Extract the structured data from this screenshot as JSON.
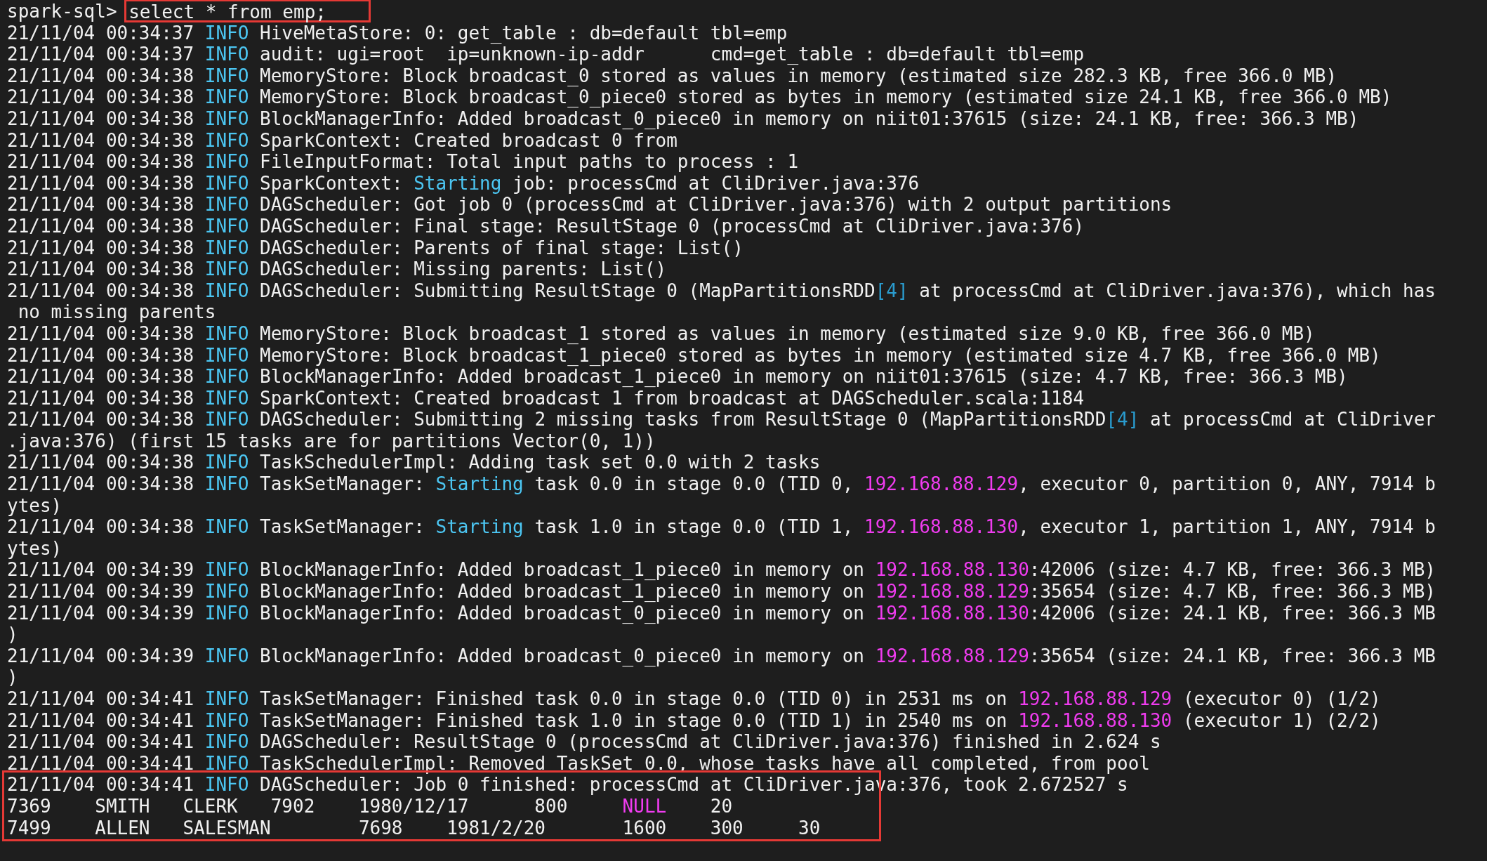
{
  "terminal": {
    "prompt_line": {
      "prompt": "spark-sql> ",
      "command": "select * from emp;",
      "command_boxed": true
    },
    "log_lines": [
      [
        {
          "kind": "plain",
          "text": "21/11/04 00:34:37 "
        },
        {
          "kind": "level",
          "text": "INFO"
        },
        {
          "kind": "plain",
          "text": " HiveMetaStore: 0: get_table : db=default tbl=emp"
        }
      ],
      [
        {
          "kind": "plain",
          "text": "21/11/04 00:34:37 "
        },
        {
          "kind": "level",
          "text": "INFO"
        },
        {
          "kind": "plain",
          "text": " audit: ugi=root  ip=unknown-ip-addr      cmd=get_table : db=default tbl=emp"
        }
      ],
      [
        {
          "kind": "plain",
          "text": "21/11/04 00:34:38 "
        },
        {
          "kind": "level",
          "text": "INFO"
        },
        {
          "kind": "plain",
          "text": " MemoryStore: Block broadcast_0 stored as values in memory (estimated size 282.3 KB, free 366.0 MB)"
        }
      ],
      [
        {
          "kind": "plain",
          "text": "21/11/04 00:34:38 "
        },
        {
          "kind": "level",
          "text": "INFO"
        },
        {
          "kind": "plain",
          "text": " MemoryStore: Block broadcast_0_piece0 stored as bytes in memory (estimated size 24.1 KB, free 366.0 MB)"
        }
      ],
      [
        {
          "kind": "plain",
          "text": "21/11/04 00:34:38 "
        },
        {
          "kind": "level",
          "text": "INFO"
        },
        {
          "kind": "plain",
          "text": " BlockManagerInfo: Added broadcast_0_piece0 in memory on niit01:37615 (size: 24.1 KB, free: 366.3 MB)"
        }
      ],
      [
        {
          "kind": "plain",
          "text": "21/11/04 00:34:38 "
        },
        {
          "kind": "level",
          "text": "INFO"
        },
        {
          "kind": "plain",
          "text": " SparkContext: Created broadcast 0 from"
        }
      ],
      [
        {
          "kind": "plain",
          "text": "21/11/04 00:34:38 "
        },
        {
          "kind": "level",
          "text": "INFO"
        },
        {
          "kind": "plain",
          "text": " FileInputFormat: Total input paths to process : 1"
        }
      ],
      [
        {
          "kind": "plain",
          "text": "21/11/04 00:34:38 "
        },
        {
          "kind": "level",
          "text": "INFO"
        },
        {
          "kind": "plain",
          "text": " SparkContext: "
        },
        {
          "kind": "keyword",
          "text": "Starting"
        },
        {
          "kind": "plain",
          "text": " job: processCmd at CliDriver.java:376"
        }
      ],
      [
        {
          "kind": "plain",
          "text": "21/11/04 00:34:38 "
        },
        {
          "kind": "level",
          "text": "INFO"
        },
        {
          "kind": "plain",
          "text": " DAGScheduler: Got job 0 (processCmd at CliDriver.java:376) with 2 output partitions"
        }
      ],
      [
        {
          "kind": "plain",
          "text": "21/11/04 00:34:38 "
        },
        {
          "kind": "level",
          "text": "INFO"
        },
        {
          "kind": "plain",
          "text": " DAGScheduler: Final stage: ResultStage 0 (processCmd at CliDriver.java:376)"
        }
      ],
      [
        {
          "kind": "plain",
          "text": "21/11/04 00:34:38 "
        },
        {
          "kind": "level",
          "text": "INFO"
        },
        {
          "kind": "plain",
          "text": " DAGScheduler: Parents of final stage: List()"
        }
      ],
      [
        {
          "kind": "plain",
          "text": "21/11/04 00:34:38 "
        },
        {
          "kind": "level",
          "text": "INFO"
        },
        {
          "kind": "plain",
          "text": " DAGScheduler: Missing parents: List()"
        }
      ],
      [
        {
          "kind": "plain",
          "text": "21/11/04 00:34:38 "
        },
        {
          "kind": "level",
          "text": "INFO"
        },
        {
          "kind": "plain",
          "text": " DAGScheduler: Submitting ResultStage 0 (MapPartitionsRDD"
        },
        {
          "kind": "index",
          "text": "[4]"
        },
        {
          "kind": "plain",
          "text": " at processCmd at CliDriver.java:376), which has"
        }
      ],
      [
        {
          "kind": "plain",
          "text": " no missing parents"
        }
      ],
      [
        {
          "kind": "plain",
          "text": "21/11/04 00:34:38 "
        },
        {
          "kind": "level",
          "text": "INFO"
        },
        {
          "kind": "plain",
          "text": " MemoryStore: Block broadcast_1 stored as values in memory (estimated size 9.0 KB, free 366.0 MB)"
        }
      ],
      [
        {
          "kind": "plain",
          "text": "21/11/04 00:34:38 "
        },
        {
          "kind": "level",
          "text": "INFO"
        },
        {
          "kind": "plain",
          "text": " MemoryStore: Block broadcast_1_piece0 stored as bytes in memory (estimated size 4.7 KB, free 366.0 MB)"
        }
      ],
      [
        {
          "kind": "plain",
          "text": "21/11/04 00:34:38 "
        },
        {
          "kind": "level",
          "text": "INFO"
        },
        {
          "kind": "plain",
          "text": " BlockManagerInfo: Added broadcast_1_piece0 in memory on niit01:37615 (size: 4.7 KB, free: 366.3 MB)"
        }
      ],
      [
        {
          "kind": "plain",
          "text": "21/11/04 00:34:38 "
        },
        {
          "kind": "level",
          "text": "INFO"
        },
        {
          "kind": "plain",
          "text": " SparkContext: Created broadcast 1 from broadcast at DAGScheduler.scala:1184"
        }
      ],
      [
        {
          "kind": "plain",
          "text": "21/11/04 00:34:38 "
        },
        {
          "kind": "level",
          "text": "INFO"
        },
        {
          "kind": "plain",
          "text": " DAGScheduler: Submitting 2 missing tasks from ResultStage 0 (MapPartitionsRDD"
        },
        {
          "kind": "index",
          "text": "[4]"
        },
        {
          "kind": "plain",
          "text": " at processCmd at CliDriver"
        }
      ],
      [
        {
          "kind": "plain",
          "text": ".java:376) (first 15 tasks are for partitions Vector(0, 1))"
        }
      ],
      [
        {
          "kind": "plain",
          "text": "21/11/04 00:34:38 "
        },
        {
          "kind": "level",
          "text": "INFO"
        },
        {
          "kind": "plain",
          "text": " TaskSchedulerImpl: Adding task set 0.0 with 2 tasks"
        }
      ],
      [
        {
          "kind": "plain",
          "text": "21/11/04 00:34:38 "
        },
        {
          "kind": "level",
          "text": "INFO"
        },
        {
          "kind": "plain",
          "text": " TaskSetManager: "
        },
        {
          "kind": "keyword",
          "text": "Starting"
        },
        {
          "kind": "plain",
          "text": " task 0.0 in stage 0.0 (TID 0, "
        },
        {
          "kind": "ip",
          "text": "192.168.88.129"
        },
        {
          "kind": "plain",
          "text": ", executor 0, partition 0, ANY, 7914 b"
        }
      ],
      [
        {
          "kind": "plain",
          "text": "ytes)"
        }
      ],
      [
        {
          "kind": "plain",
          "text": "21/11/04 00:34:38 "
        },
        {
          "kind": "level",
          "text": "INFO"
        },
        {
          "kind": "plain",
          "text": " TaskSetManager: "
        },
        {
          "kind": "keyword",
          "text": "Starting"
        },
        {
          "kind": "plain",
          "text": " task 1.0 in stage 0.0 (TID 1, "
        },
        {
          "kind": "ip",
          "text": "192.168.88.130"
        },
        {
          "kind": "plain",
          "text": ", executor 1, partition 1, ANY, 7914 b"
        }
      ],
      [
        {
          "kind": "plain",
          "text": "ytes)"
        }
      ],
      [
        {
          "kind": "plain",
          "text": "21/11/04 00:34:39 "
        },
        {
          "kind": "level",
          "text": "INFO"
        },
        {
          "kind": "plain",
          "text": " BlockManagerInfo: Added broadcast_1_piece0 in memory on "
        },
        {
          "kind": "ip",
          "text": "192.168.88.130"
        },
        {
          "kind": "plain",
          "text": ":42006 (size: 4.7 KB, free: 366.3 MB)"
        }
      ],
      [
        {
          "kind": "plain",
          "text": "21/11/04 00:34:39 "
        },
        {
          "kind": "level",
          "text": "INFO"
        },
        {
          "kind": "plain",
          "text": " BlockManagerInfo: Added broadcast_1_piece0 in memory on "
        },
        {
          "kind": "ip",
          "text": "192.168.88.129"
        },
        {
          "kind": "plain",
          "text": ":35654 (size: 4.7 KB, free: 366.3 MB)"
        }
      ],
      [
        {
          "kind": "plain",
          "text": "21/11/04 00:34:39 "
        },
        {
          "kind": "level",
          "text": "INFO"
        },
        {
          "kind": "plain",
          "text": " BlockManagerInfo: Added broadcast_0_piece0 in memory on "
        },
        {
          "kind": "ip",
          "text": "192.168.88.130"
        },
        {
          "kind": "plain",
          "text": ":42006 (size: 24.1 KB, free: 366.3 MB"
        }
      ],
      [
        {
          "kind": "plain",
          "text": ")"
        }
      ],
      [
        {
          "kind": "plain",
          "text": "21/11/04 00:34:39 "
        },
        {
          "kind": "level",
          "text": "INFO"
        },
        {
          "kind": "plain",
          "text": " BlockManagerInfo: Added broadcast_0_piece0 in memory on "
        },
        {
          "kind": "ip",
          "text": "192.168.88.129"
        },
        {
          "kind": "plain",
          "text": ":35654 (size: 24.1 KB, free: 366.3 MB"
        }
      ],
      [
        {
          "kind": "plain",
          "text": ")"
        }
      ],
      [
        {
          "kind": "plain",
          "text": "21/11/04 00:34:41 "
        },
        {
          "kind": "level",
          "text": "INFO"
        },
        {
          "kind": "plain",
          "text": " TaskSetManager: Finished task 0.0 in stage 0.0 (TID 0) in 2531 ms on "
        },
        {
          "kind": "ip",
          "text": "192.168.88.129"
        },
        {
          "kind": "plain",
          "text": " (executor 0) (1/2)"
        }
      ],
      [
        {
          "kind": "plain",
          "text": "21/11/04 00:34:41 "
        },
        {
          "kind": "level",
          "text": "INFO"
        },
        {
          "kind": "plain",
          "text": " TaskSetManager: Finished task 1.0 in stage 0.0 (TID 1) in 2540 ms on "
        },
        {
          "kind": "ip",
          "text": "192.168.88.130"
        },
        {
          "kind": "plain",
          "text": " (executor 1) (2/2)"
        }
      ],
      [
        {
          "kind": "plain",
          "text": "21/11/04 00:34:41 "
        },
        {
          "kind": "level",
          "text": "INFO"
        },
        {
          "kind": "plain",
          "text": " DAGScheduler: ResultStage 0 (processCmd at CliDriver.java:376) finished in 2.624 s"
        }
      ],
      [
        {
          "kind": "plain",
          "text": "21/11/04 00:34:41 "
        },
        {
          "kind": "level",
          "text": "INFO"
        },
        {
          "kind": "plain",
          "text": " TaskSchedulerImpl: Removed TaskSet 0.0, whose tasks have all completed, from pool"
        }
      ]
    ],
    "highlighted_block": {
      "boxed": true,
      "lines": [
        [
          {
            "kind": "plain",
            "text": "21/11/04 00:34:41 "
          },
          {
            "kind": "level",
            "text": "INFO"
          },
          {
            "kind": "plain",
            "text": " DAGScheduler: Job 0 finished: processCmd at CliDriver.java:376, took 2.672527 s"
          }
        ],
        [
          {
            "kind": "plain",
            "text": "7369    SMITH   CLERK   7902    1980/12/17      800     "
          },
          {
            "kind": "null",
            "text": "NULL"
          },
          {
            "kind": "plain",
            "text": "    20"
          }
        ],
        [
          {
            "kind": "plain",
            "text": "7499    ALLEN   SALESMAN        7698    1981/2/20       1600    300     30"
          }
        ]
      ]
    }
  }
}
